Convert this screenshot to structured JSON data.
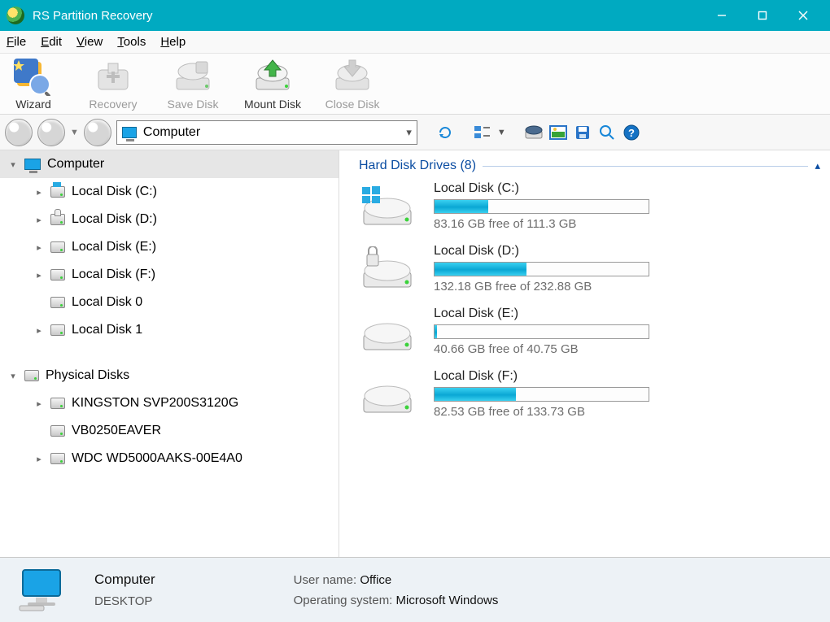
{
  "title": "RS Partition Recovery",
  "menu": {
    "file": "File",
    "edit": "Edit",
    "view": "View",
    "tools": "Tools",
    "help": "Help"
  },
  "toolbar": {
    "wizard": "Wizard",
    "recovery": "Recovery",
    "saveDisk": "Save Disk",
    "mountDisk": "Mount Disk",
    "closeDisk": "Close Disk"
  },
  "address": {
    "value": "Computer"
  },
  "tree": {
    "root": "Computer",
    "disks": [
      {
        "label": "Local Disk (C:)"
      },
      {
        "label": "Local Disk (D:)"
      },
      {
        "label": "Local Disk (E:)"
      },
      {
        "label": "Local Disk (F:)"
      },
      {
        "label": "Local Disk 0"
      },
      {
        "label": "Local Disk 1"
      }
    ],
    "physicalHeader": "Physical Disks",
    "physical": [
      {
        "label": "KINGSTON SVP200S3120G"
      },
      {
        "label": "VB0250EAVER"
      },
      {
        "label": "WDC WD5000AAKS-00E4A0"
      }
    ]
  },
  "group": {
    "title": "Hard Disk Drives (8)"
  },
  "drives": [
    {
      "title": "Local Disk (C:)",
      "freeText": "83.16 GB free of 111.3 GB",
      "usedPct": 25
    },
    {
      "title": "Local Disk (D:)",
      "freeText": "132.18 GB free of 232.88 GB",
      "usedPct": 43
    },
    {
      "title": "Local Disk (E:)",
      "freeText": "40.66 GB free of 40.75 GB",
      "usedPct": 1
    },
    {
      "title": "Local Disk (F:)",
      "freeText": "82.53 GB free of 133.73 GB",
      "usedPct": 38
    }
  ],
  "status": {
    "name": "Computer",
    "host": "DESKTOP",
    "userKey": "User name:",
    "userVal": "Office",
    "osKey": "Operating system:",
    "osVal": "Microsoft Windows"
  }
}
